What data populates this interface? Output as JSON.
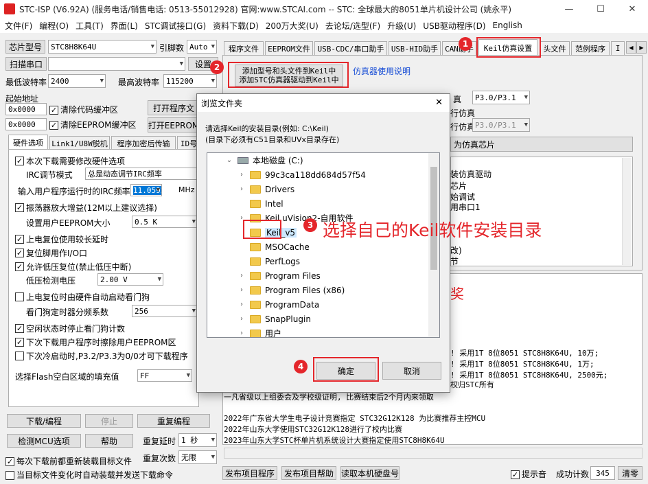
{
  "app": {
    "title": "STC-ISP (V6.92A) (服务电话/销售电话: 0513-55012928) 官网:www.STCAI.com  -- STC: 全球最大的8051单片机设计公司 (姚永平)",
    "window_controls": [
      "—",
      "☐",
      "✕"
    ]
  },
  "menu": [
    "文件(F)",
    "编程(O)",
    "工具(T)",
    "界面(L)",
    "STC调试接口(G)",
    "资料下载(D)",
    "200万大奖(U)",
    "去论坛/选型(F)",
    "升级(U)",
    "USB驱动程序(D)",
    "English"
  ],
  "left": {
    "chip_label": "芯片型号",
    "chip_value": "STC8H8K64U",
    "pin_label": "引脚数",
    "pin_value": "Auto",
    "scan_btn": "扫描串口",
    "settings_btn": "设置",
    "min_baud_label": "最低波特率",
    "min_baud_value": "2400",
    "max_baud_label": "最高波特率",
    "max_baud_value": "115200",
    "start_addr_label": "起始地址",
    "addr1": "0x0000",
    "clear_code_label": "清除代码缓冲区",
    "open_prog_btn": "打开程序文",
    "addr2": "0x0000",
    "clear_eeprom_label": "清除EEPROM缓冲区",
    "open_eeprom_btn": "打开EEPROM",
    "tabs": [
      "硬件选项",
      "Link1/U8W脱机",
      "程序加密后传输",
      "ID号"
    ],
    "options": [
      {
        "text": "本次下载需要修改硬件选项",
        "checked": true
      },
      {
        "text": "IRC调节模式",
        "combo": "总是动态调节IRC频率"
      },
      {
        "text": "输入用户程序运行时的IRC频率",
        "combo": "11.0592",
        "unit": "MHz"
      },
      {
        "text": "振荡器放大增益(12M以上建议选择)",
        "checked": true
      },
      {
        "text": "设置用户EEPROM大小",
        "combo": "0.5 K"
      },
      {
        "text": "上电复位使用较长延时",
        "checked": true
      },
      {
        "text": "复位脚用作I/O口",
        "checked": true
      },
      {
        "text": "允许低压复位(禁止低压中断)",
        "checked": true
      },
      {
        "text": "低压检测电压",
        "combo": "2.00 V"
      },
      {
        "text": "上电复位时由硬件自动启动看门狗",
        "checked": false
      },
      {
        "text": "看门狗定时器分频系数",
        "combo": "256"
      },
      {
        "text": "空闲状态时停止看门狗计数",
        "checked": true
      },
      {
        "text": "下次下载用户程序时擦除用户EEPROM区",
        "checked": true
      },
      {
        "text": "下次冷启动时,P3.2/P3.3为0/0才可下载程序",
        "checked": false
      },
      {
        "text": "选择Flash空白区域的填充值",
        "combo": "FF"
      }
    ],
    "download_btn": "下载/编程",
    "stop_btn": "停止",
    "reprogram_btn": "重复编程",
    "detect_btn": "检测MCU选项",
    "help_btn": "帮助",
    "repeat_delay_label": "重复延时",
    "repeat_delay_value": "1 秒",
    "repeat_count_label": "重复次数",
    "repeat_count_value": "无限",
    "reload_label": "每次下载前都重新装载目标文件",
    "auto_send_label": "当目标文件变化时自动装载并发送下载命令"
  },
  "right": {
    "tabs": [
      "程序文件",
      "EEPROM文件",
      "USB-CDC/串口助手",
      "USB-HID助手",
      "CAN助手",
      "Keil仿真设置",
      "头文件",
      "范例程序",
      "I"
    ],
    "add_keil_line1": "添加型号和头文件到Keil中",
    "add_keil_line2": "添加STC仿真器驱动到Keil中",
    "emu_manual": "仿真器使用说明",
    "bg_text_fragments": [
      "真",
      "P3.0/P3.1",
      "行仿真",
      "行仿真",
      "P3.0/P3.1",
      "为仿真芯片",
      "装仿真驱动",
      "芯片",
      "始调试",
      "用串口1",
      "改)",
      "节",
      "奖"
    ],
    "log": [
      "! 采用1T 8位8051 STC8H8K64U, 10万;",
      "! 采用1T 8位8051 STC8H8K64U, 1万;",
      "! 采用1T 8位8051 STC8H8K64U, 2500元;",
      "权归STC所有",
      "一凡省级以上组委会及学校级证明, 比赛结束后2个月内来领取",
      "",
      "2022年广东省大学生电子设计竞赛指定 STC32G12K128 为比赛推荐主控MCU",
      "2022年山东大学使用STC32G12K128进行了校内比赛",
      "2023年山东大学STC杯单片机系统设计大赛指定使用STC8H8K64U"
    ],
    "publish_btn": "发布项目程序",
    "publish_help_btn": "发布项目帮助",
    "read_disk_btn": "读取本机硬盘号",
    "beep_label": "提示音",
    "success_label": "成功计数",
    "success_value": "345",
    "clear_btn": "清零"
  },
  "dialog": {
    "title": "浏览文件夹",
    "close": "✕",
    "instruction_line1": "请选择Keil的安装目录(例如: C:\\Keil)",
    "instruction_line2": "(目录下必须有C51目录和UVx目录存在)",
    "root": "本地磁盘 (C:)",
    "folders": [
      "99c3ca118dd684d57f54",
      "Drivers",
      "Intel",
      "Keil uVision2-自用软件",
      "Keil_v5",
      "MSOCache",
      "PerfLogs",
      "Program Files",
      "Program Files (x86)",
      "ProgramData",
      "SnapPlugin",
      "用户"
    ],
    "ok_btn": "确定",
    "cancel_btn": "取消"
  },
  "annotations": {
    "badges": [
      "1",
      "2",
      "3",
      "4"
    ],
    "note": "选择自己的Keil软件安装目录",
    "accent": "#e4262b"
  }
}
